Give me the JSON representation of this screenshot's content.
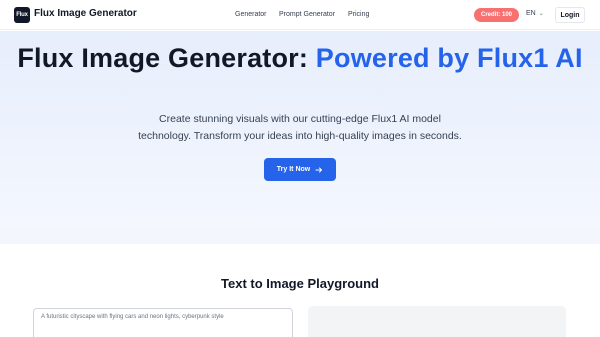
{
  "header": {
    "logo_text": "Flux",
    "brand": "Flux Image Generator",
    "nav": [
      "Generator",
      "Prompt Generator",
      "Pricing"
    ],
    "credit": "Credit: 100",
    "language": "EN",
    "login": "Login"
  },
  "hero": {
    "title_main": "Flux Image Generator: ",
    "title_accent": "Powered by Flux1 AI",
    "subtitle_line1": "Create stunning visuals with our cutting-edge Flux1 AI model",
    "subtitle_line2": "technology. Transform your ideas into high-quality images in seconds.",
    "cta_label": "Try It Now"
  },
  "playground": {
    "title": "Text to Image Playground",
    "prompt_placeholder": "A futuristic cityscape with flying cars and neon lights, cyberpunk style"
  },
  "colors": {
    "accent": "#2563eb",
    "credit_badge": "#f87171"
  }
}
